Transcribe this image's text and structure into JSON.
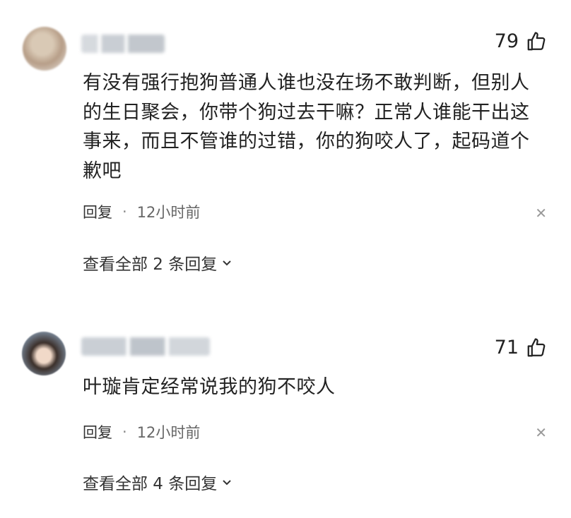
{
  "comments": [
    {
      "username": "",
      "likes": "79",
      "text": "有没有强行抱狗普通人谁也没在场不敢判断，但别人的生日聚会，你带个狗过去干嘛？正常人谁能干出这事来，而且不管谁的过错，你的狗咬人了，起码道个歉吧",
      "reply_label": "回复",
      "time": "12小时前",
      "view_all": "查看全部 2 条回复"
    },
    {
      "username": "",
      "likes": "71",
      "text": "叶璇肯定经常说我的狗不咬人",
      "reply_label": "回复",
      "time": "12小时前",
      "view_all": "查看全部 4 条回复"
    }
  ],
  "icons": {
    "like": "thumbs-up-icon",
    "close": "close-icon",
    "expand": "chevron-down-icon"
  },
  "colors": {
    "text": "#222222",
    "meta": "#555555",
    "muted": "#999999"
  }
}
